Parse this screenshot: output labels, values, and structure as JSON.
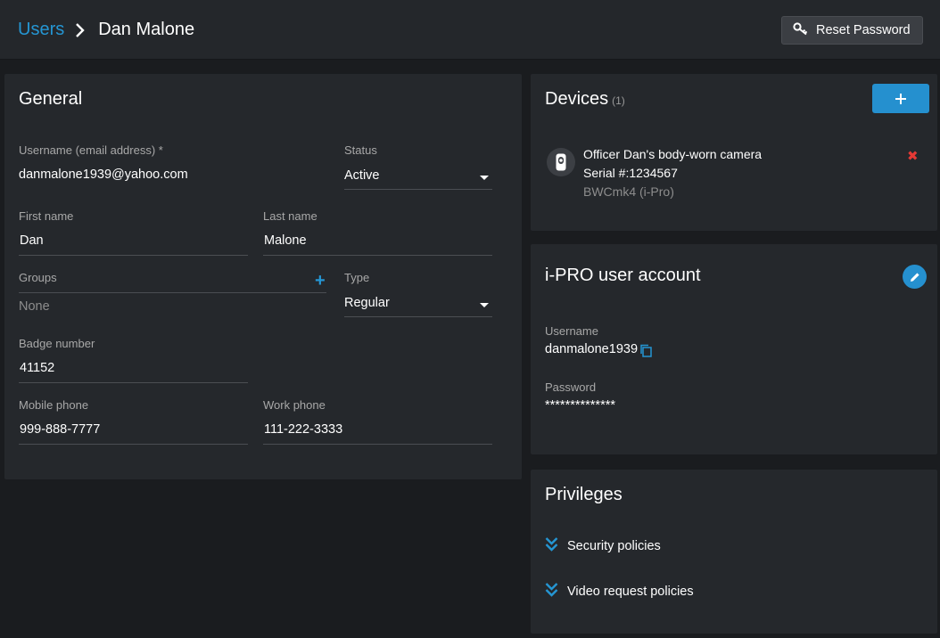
{
  "breadcrumb": {
    "parent": "Users",
    "current": "Dan Malone"
  },
  "header": {
    "reset_password": "Reset Password"
  },
  "general": {
    "title": "General",
    "username_label": "Username (email address) *",
    "username_value": "danmalone1939@yahoo.com",
    "status_label": "Status",
    "status_value": "Active",
    "first_name_label": "First name",
    "first_name_value": "Dan",
    "last_name_label": "Last name",
    "last_name_value": "Malone",
    "groups_label": "Groups",
    "groups_value": "None",
    "type_label": "Type",
    "type_value": "Regular",
    "badge_label": "Badge number",
    "badge_value": "41152",
    "mobile_label": "Mobile phone",
    "mobile_value": "999-888-7777",
    "work_label": "Work phone",
    "work_value": "111-222-3333"
  },
  "devices": {
    "title": "Devices",
    "count": "(1)",
    "items": [
      {
        "name": "Officer Dan's body-worn camera",
        "serial": "Serial #:1234567",
        "model": "BWCmk4 (i-Pro)"
      }
    ]
  },
  "ipro": {
    "title": "i-PRO user account",
    "username_label": "Username",
    "username_value": "danmalone1939",
    "password_label": "Password",
    "password_value": "**************"
  },
  "privileges": {
    "title": "Privileges",
    "items": [
      {
        "label": "Security policies"
      },
      {
        "label": "Video request policies"
      }
    ]
  },
  "colors": {
    "accent": "#2596d3",
    "danger": "#e53935",
    "panel": "#25282c",
    "background": "#1a1c1f"
  }
}
